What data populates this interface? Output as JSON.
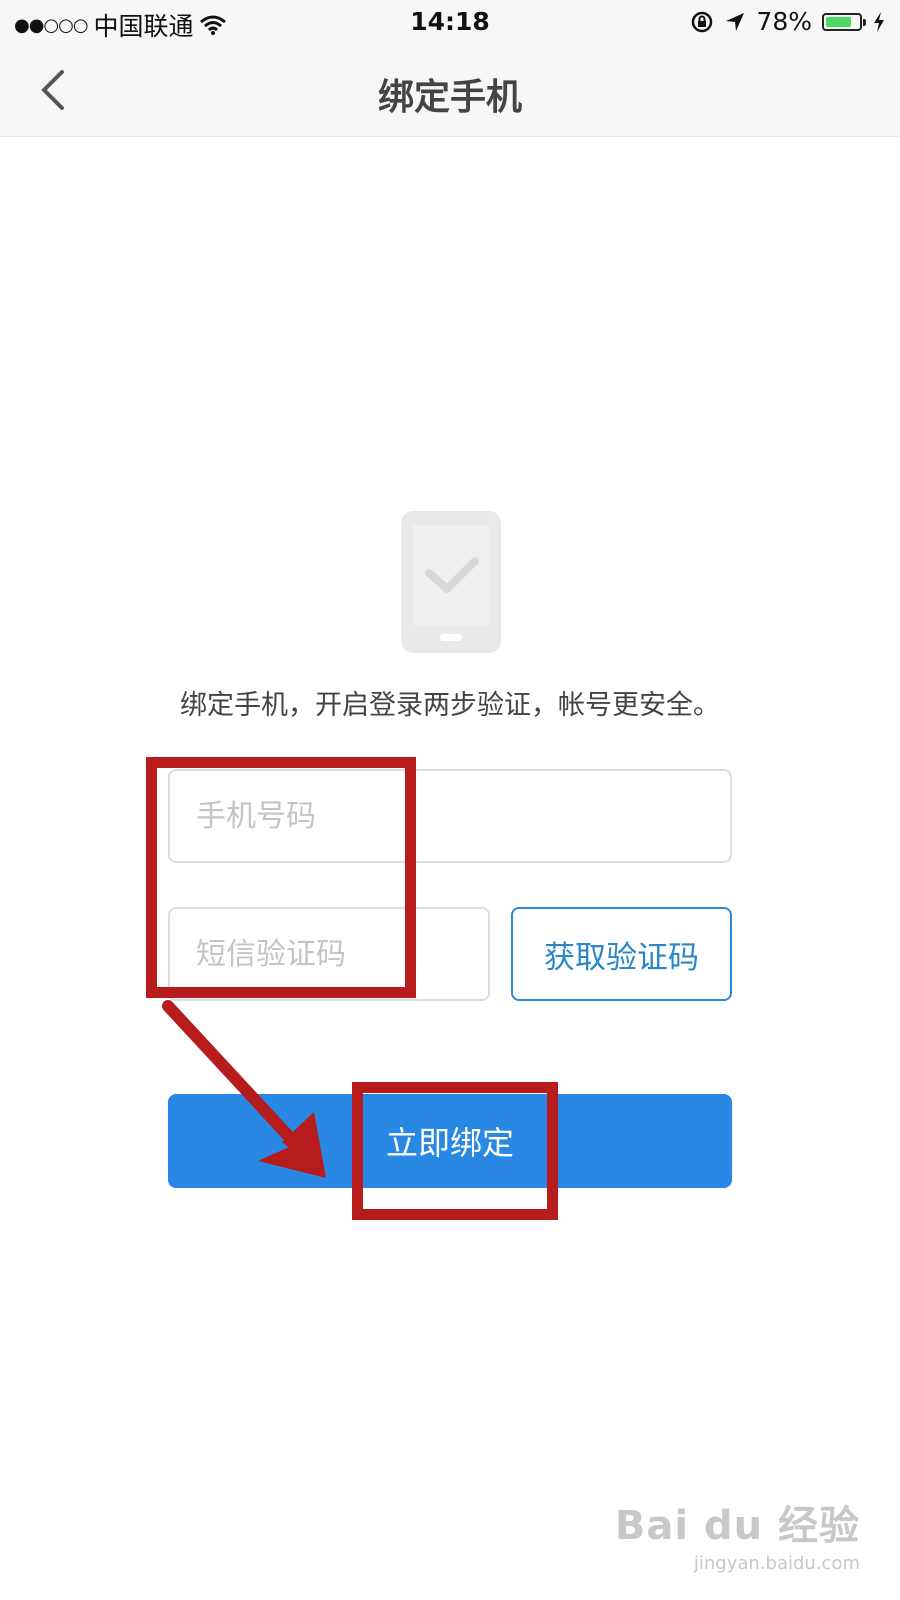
{
  "status_bar": {
    "signal": "●●○○○",
    "carrier": "中国联通",
    "time": "14:18",
    "battery_percent": "78%",
    "battery_level": 0.78,
    "icons": [
      "wifi-icon",
      "rotation-lock-icon",
      "location-arrow-icon",
      "battery-icon",
      "charging-bolt-icon"
    ]
  },
  "nav": {
    "title": "绑定手机",
    "back_icon": "chevron-left-icon"
  },
  "main": {
    "illustration_icon": "phone-check-icon",
    "tip": "绑定手机，开启登录两步验证，帐号更安全。",
    "phone_placeholder": "手机号码",
    "code_placeholder": "短信验证码",
    "get_code_label": "获取验证码",
    "bind_label": "立即绑定"
  },
  "watermark": {
    "main": "Bai du 经验",
    "sub": "jingyan.baidu.com"
  },
  "colors": {
    "primary": "#2888e3",
    "link_blue": "#2b86c8",
    "annotation_red": "#b71c1c",
    "battery_green": "#4cd964"
  }
}
